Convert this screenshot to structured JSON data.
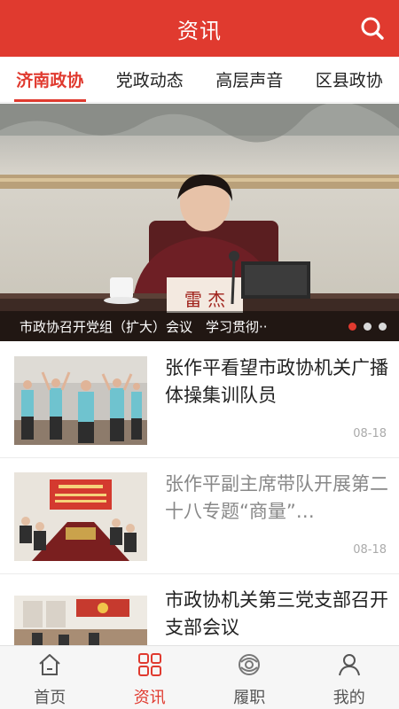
{
  "header": {
    "title": "资讯",
    "search_icon": "search-icon",
    "color": "#e03a2f"
  },
  "tabs": [
    {
      "label": "济南政协",
      "active": true
    },
    {
      "label": "党政动态",
      "active": false
    },
    {
      "label": "高层声音",
      "active": false
    },
    {
      "label": "区县政协",
      "active": false
    }
  ],
  "banner": {
    "caption": "市政协召开党组（扩大）会议　学习贯彻··",
    "nameplate": "雷 杰",
    "slide_count": 3,
    "active_slide": 1
  },
  "news": [
    {
      "title": "张作平看望市政协机关广播体操集训队员",
      "date": "08-18",
      "read": false
    },
    {
      "title": "张作平副主席带队开展第二十八专题“商量”…",
      "date": "08-18",
      "read": true
    },
    {
      "title": "市政协机关第三党支部召开支部会议",
      "date": "",
      "read": false
    }
  ],
  "bottom_nav": [
    {
      "label": "首页",
      "icon": "home-icon",
      "active": false
    },
    {
      "label": "资讯",
      "icon": "grid-icon",
      "active": true
    },
    {
      "label": "履职",
      "icon": "swirl-icon",
      "active": false
    },
    {
      "label": "我的",
      "icon": "user-icon",
      "active": false
    }
  ]
}
